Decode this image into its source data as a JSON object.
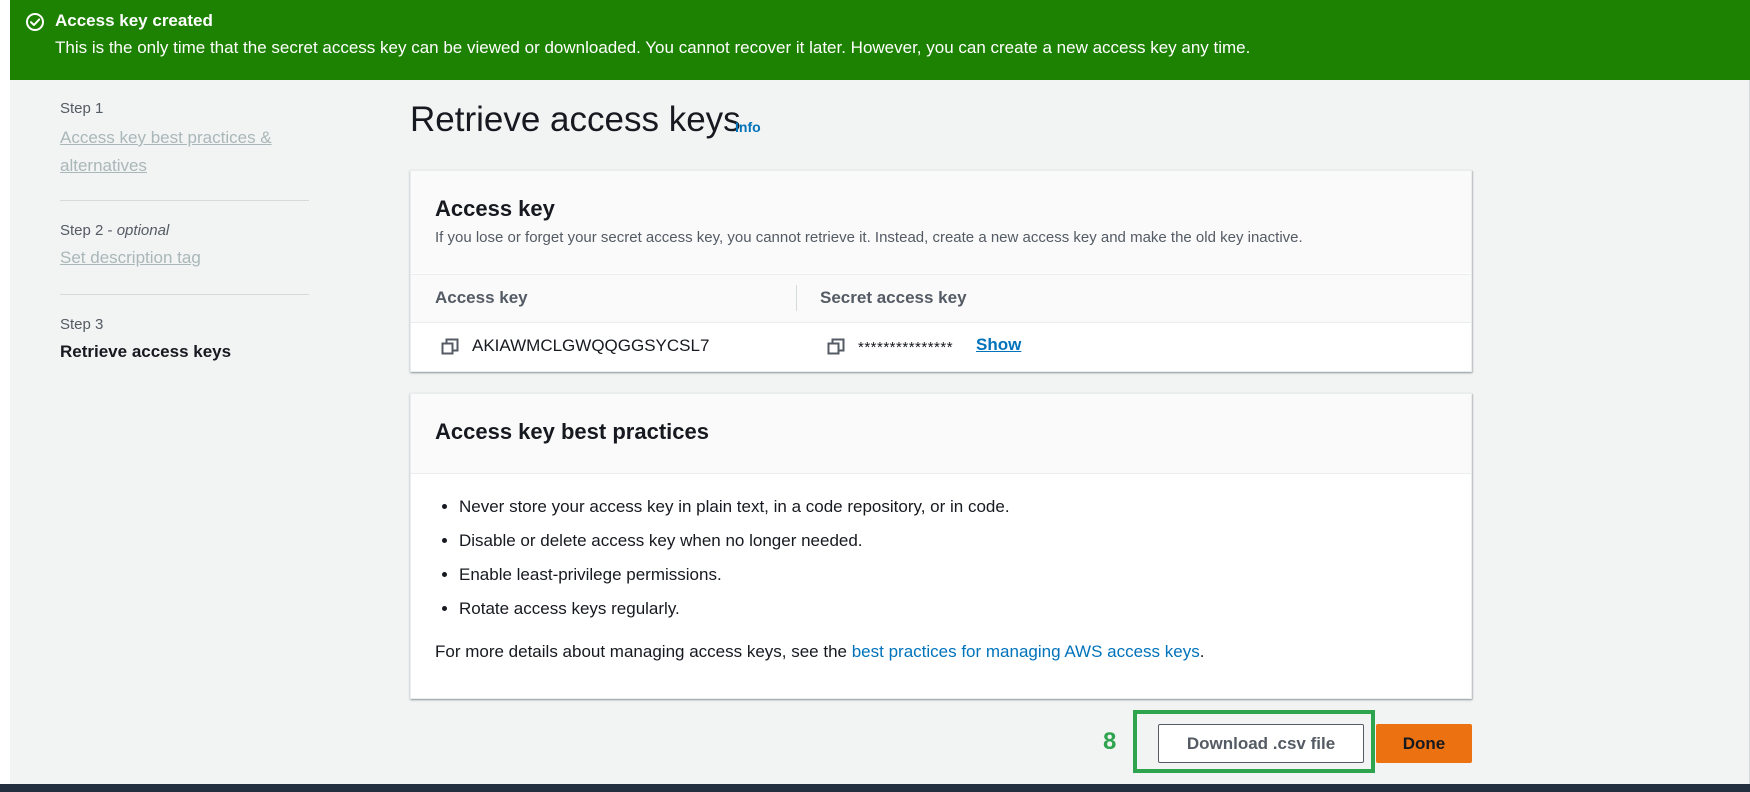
{
  "flash": {
    "title": "Access key created",
    "message": "This is the only time that the secret access key can be viewed or downloaded. You cannot recover it later. However, you can create a new access key any time.",
    "icon": "success-check-circle-icon",
    "color": "#1d8102"
  },
  "steps": [
    {
      "label": "Step 1",
      "title": "Access key best practices & alternatives",
      "state": "completed"
    },
    {
      "label": "Step 2",
      "label_suffix": "optional",
      "title": "Set description tag",
      "state": "completed"
    },
    {
      "label": "Step 3",
      "title": "Retrieve access keys",
      "state": "current"
    }
  ],
  "header": {
    "title": "Retrieve access keys",
    "info_link": "Info"
  },
  "access_key_panel": {
    "title": "Access key",
    "description": "If you lose or forget your secret access key, you cannot retrieve it. Instead, create a new access key and make the old key inactive.",
    "columns": [
      "Access key",
      "Secret access key"
    ],
    "access_key_value": "AKIAWMCLGWQQGGSYCSL7",
    "secret_masked": "***************",
    "show_label": "Show",
    "copy_icon": "copy-icon"
  },
  "best_practices_panel": {
    "title": "Access key best practices",
    "items": [
      "Never store your access key in plain text, in a code repository, or in code.",
      "Disable or delete access key when no longer needed.",
      "Enable least-privilege permissions.",
      "Rotate access keys regularly."
    ],
    "more_prefix": "For more details about managing access keys, see the ",
    "more_link": "best practices for managing AWS access keys",
    "more_suffix": "."
  },
  "footer": {
    "annotation_number": "8",
    "download_label": "Download .csv file",
    "done_label": "Done",
    "primary_color": "#ec7211",
    "highlight_color": "#2ea44f"
  }
}
